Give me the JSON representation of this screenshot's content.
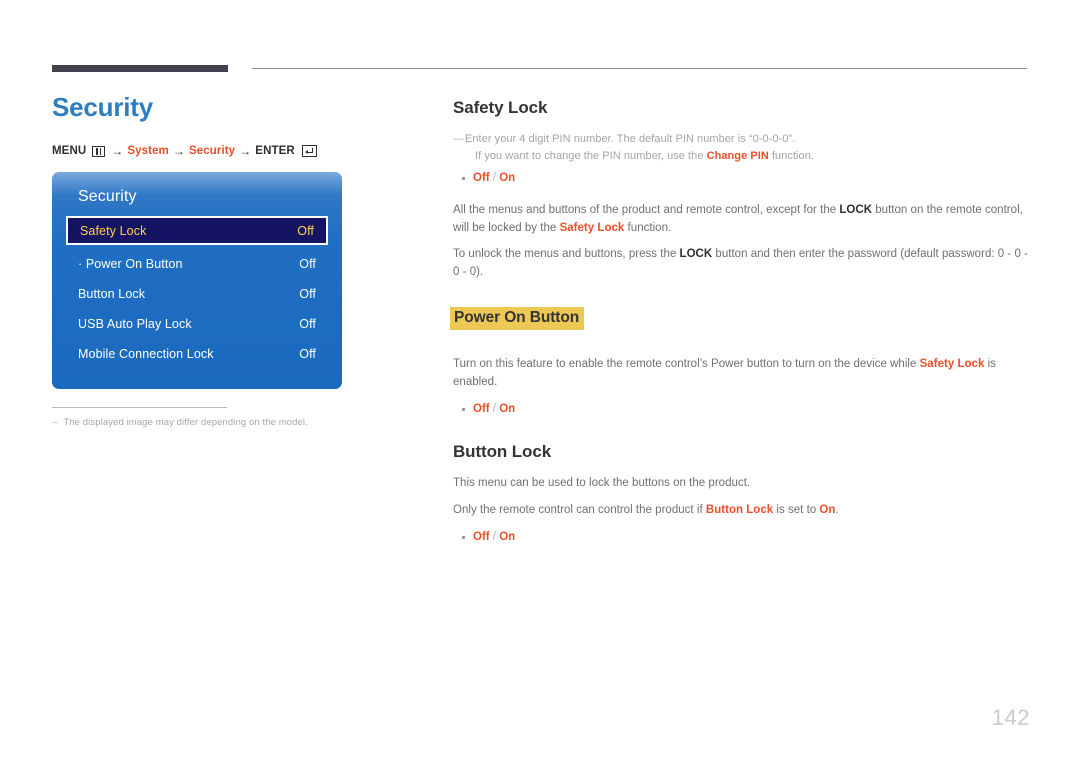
{
  "header": {
    "rule_color": "#45424f",
    "line_color": "#8c8c92"
  },
  "left": {
    "page_title": "Security",
    "menu_path": {
      "prefix": "MENU",
      "menu_icon": "menu-grid-icon",
      "arrow1": "→",
      "step1": "System",
      "arrow2": "→",
      "step2": "Security",
      "arrow3": "→",
      "enter": "ENTER",
      "enter_icon": "enter-key-icon"
    },
    "osd": {
      "title": "Security",
      "rows": [
        {
          "label": "Safety Lock",
          "value": "Off",
          "selected": true
        },
        {
          "label": "· Power On Button",
          "value": "Off",
          "selected": false
        },
        {
          "label": "Button Lock",
          "value": "Off",
          "selected": false
        },
        {
          "label": "USB Auto Play Lock",
          "value": "Off",
          "selected": false
        },
        {
          "label": "Mobile Connection Lock",
          "value": "Off",
          "selected": false
        }
      ]
    },
    "caption": {
      "dash": "–",
      "text": "The displayed image may differ depending on the model."
    }
  },
  "right": {
    "safety_lock": {
      "heading": "Safety Lock",
      "note_line1": "Enter your 4 digit PIN number. The default PIN number is “0-0-0-0”.",
      "note_line2_a": "If you want to change the PIN number, use the ",
      "note_line2_b": "Change PIN",
      "note_line2_c": " function.",
      "options_off": "Off",
      "options_sep": " / ",
      "options_on": "On",
      "para1_a": "All the menus and buttons of the product and remote control, except for the ",
      "para1_b": "LOCK",
      "para1_c": " button on the remote control, will be locked by the ",
      "para1_d": "Safety Lock",
      "para1_e": " function.",
      "para2_a": "To unlock the menus and buttons, press the ",
      "para2_b": "LOCK",
      "para2_c": " button and then enter the password (default password: 0 - 0 - 0 - 0)."
    },
    "power_on_button": {
      "heading": "Power On Button",
      "highlight_color": "#edc855",
      "para_a": "Turn on this feature to enable the remote control’s Power button to turn on the device while ",
      "para_b": "Safety Lock",
      "para_c": " is enabled.",
      "options_off": "Off",
      "options_sep": " / ",
      "options_on": "On"
    },
    "button_lock": {
      "heading": "Button Lock",
      "para1": "This menu can be used to lock the buttons on the product.",
      "para2_a": "Only the remote control can control the product if ",
      "para2_b": "Button Lock",
      "para2_c": " is set to ",
      "para2_d": "On",
      "para2_e": ".",
      "options_off": "Off",
      "options_sep": " / ",
      "options_on": "On"
    }
  },
  "page_number": "142"
}
